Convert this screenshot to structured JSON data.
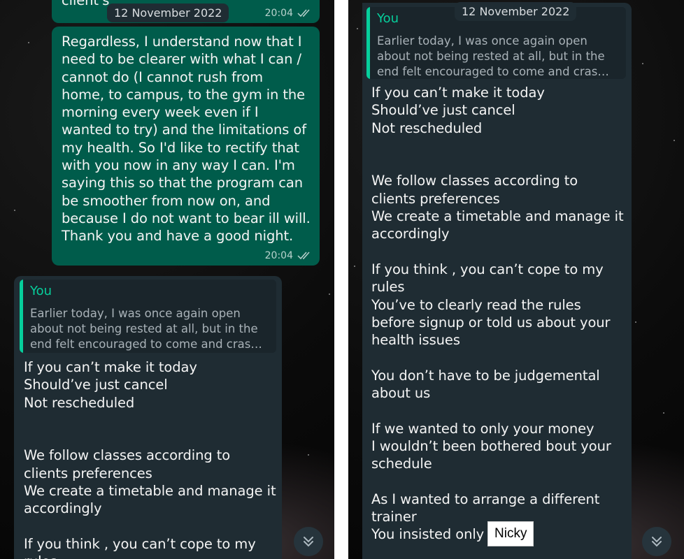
{
  "left": {
    "top_bubble_fragment": "client's",
    "date_chip": "12 November 2022",
    "top_bubble_time": "20:04",
    "outgoing": {
      "text": "Regardless, I understand now that I\nneed to be clearer with what I can /\ncannot do (I cannot rush from\nhome, to campus, to the gym in the\nmorning every week even if I\nwanted to try) and the limitations of\nmy health. So I'd like to rectify that\nwith you now in any way I can. I'm\nsaying this so that the program can\nbe smoother from now on, and\nbecause I do not want to bear ill will.\nThank you and have a good night.",
      "time": "20:04"
    },
    "incoming": {
      "quote_author": "You",
      "quote_text": "Earlier today, I was once again open\nabout not being rested at all, but in the\nend felt encouraged to come and cras…",
      "text": "If you can’t make it today\nShould’ve just cancel\nNot rescheduled\n\n\nWe follow classes according to\nclients preferences\nWe create a timetable and manage it\naccordingly\n\nIf you think , you can’t cope to my\nrules"
    }
  },
  "right": {
    "date_chip": "12 November 2022",
    "incoming": {
      "quote_author": "You",
      "quote_text": "Earlier today, I was once again open\nabout not being rested at all, but in the\nend felt encouraged to come and cras…",
      "text": "If you can’t make it today\nShould’ve just cancel\nNot rescheduled\n\n\nWe follow classes according to\nclients preferences\nWe create a timetable and manage it\naccordingly\n\nIf you think , you can’t cope to my\nrules\nYou’ve to clearly read the rules\nbefore signup or told us about your\nhealth issues\n\nYou don’t have to be judgemental\nabout us\n\nIf we wanted to only your money\nI wouldn’t been bothered bout your\nschedule\n\nAs I wanted to arrange a different\ntrainer\nYou insisted only"
    },
    "name_label": "Nicky"
  },
  "colors": {
    "outgoing_bubble": "#005c4b",
    "incoming_bubble": "#1f2c33",
    "quote_accent": "#06cf9c",
    "background": "#0b0b0b"
  },
  "icons": {
    "read_receipt": "double-check-icon",
    "scroll_down": "chevron-double-down-icon"
  }
}
